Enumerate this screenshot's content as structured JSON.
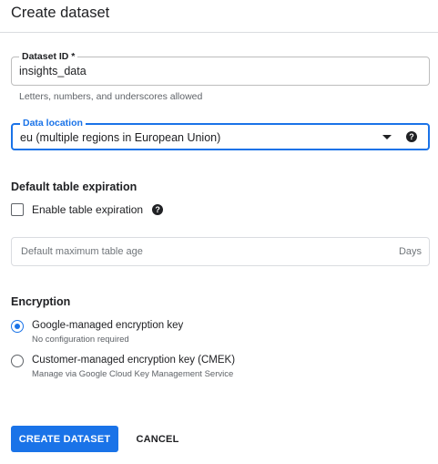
{
  "dialog": {
    "title": "Create dataset"
  },
  "dataset_id": {
    "label": "Dataset ID *",
    "value": "insights_data",
    "hint": "Letters, numbers, and underscores allowed"
  },
  "data_location": {
    "label": "Data location",
    "value": "eu (multiple regions in European Union)",
    "help_icon": "?",
    "arrow_icon": "dropdown-arrow",
    "focused_color": "#1a73e8"
  },
  "expiration": {
    "title": "Default table expiration",
    "checkbox_label": "Enable table expiration",
    "checked": false,
    "help_icon": "?",
    "input_placeholder": "Default maximum table age",
    "input_suffix": "Days"
  },
  "encryption": {
    "title": "Encryption",
    "options": [
      {
        "label": "Google-managed encryption key",
        "sublabel": "No configuration required",
        "selected": true
      },
      {
        "label": "Customer-managed encryption key (CMEK)",
        "sublabel": "Manage via Google Cloud Key Management Service",
        "selected": false
      }
    ]
  },
  "actions": {
    "create_label": "CREATE DATASET",
    "cancel_label": "CANCEL"
  },
  "colors": {
    "primary": "#1a73e8",
    "text": "#202124",
    "secondary_text": "#5f6368",
    "divider": "#dadce0"
  }
}
